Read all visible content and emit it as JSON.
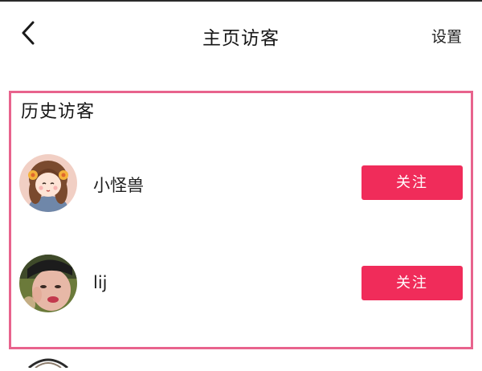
{
  "header": {
    "back_icon": "chevron-left-icon",
    "title": "主页访客",
    "settings_label": "设置"
  },
  "history": {
    "title": "历史访客",
    "visitors": [
      {
        "name": "小怪兽",
        "avatar": "cartoon-girl-avatar",
        "follow_label": "关注"
      },
      {
        "name": "lij",
        "avatar": "photo-avatar",
        "follow_label": "关注"
      }
    ]
  },
  "colors": {
    "accent": "#f02c5a",
    "highlight_border": "#e8638d",
    "text": "#161616",
    "background": "#ffffff"
  }
}
